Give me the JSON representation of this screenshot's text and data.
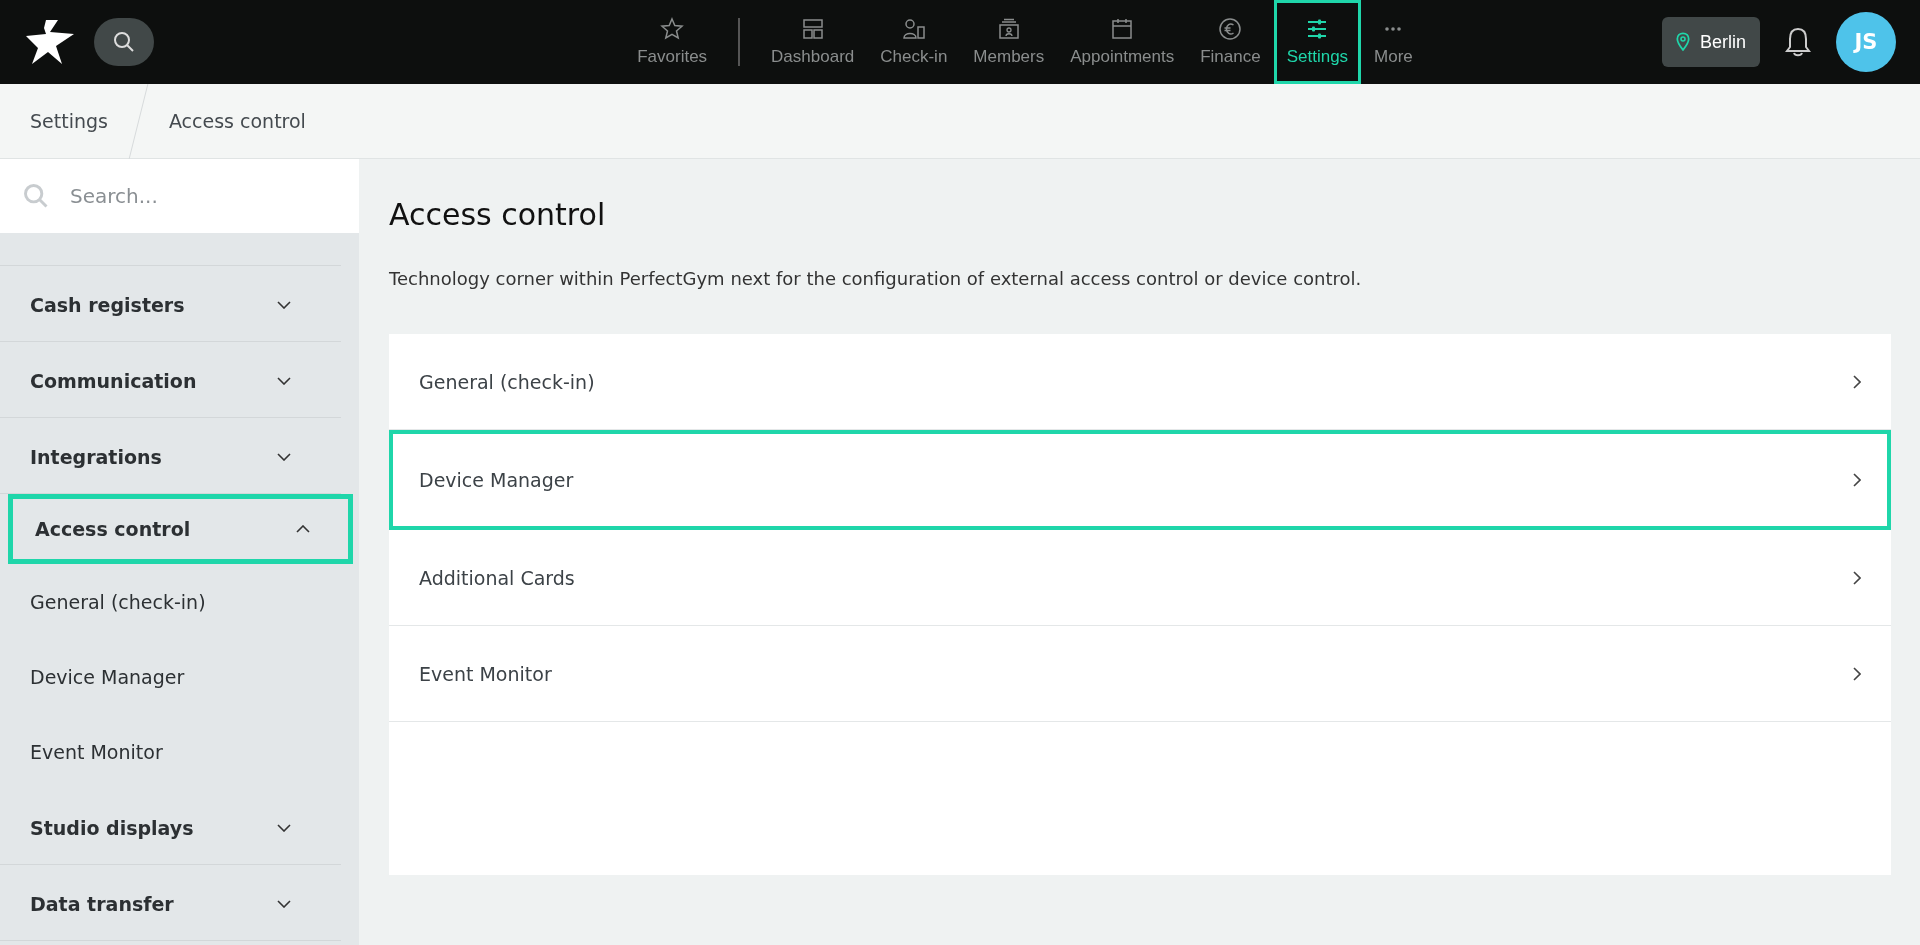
{
  "nav": {
    "items": [
      {
        "kind": "star",
        "label": "Favorites",
        "selected": false,
        "highlighted": false
      },
      {
        "kind": "dashboard",
        "label": "Dashboard",
        "selected": false,
        "highlighted": false
      },
      {
        "kind": "checkin",
        "label": "Check-in",
        "selected": false,
        "highlighted": false
      },
      {
        "kind": "members",
        "label": "Members",
        "selected": false,
        "highlighted": false
      },
      {
        "kind": "calendar",
        "label": "Appointments",
        "selected": false,
        "highlighted": false
      },
      {
        "kind": "euro",
        "label": "Finance",
        "selected": false,
        "highlighted": false
      },
      {
        "kind": "sliders",
        "label": "Settings",
        "selected": true,
        "highlighted": true
      },
      {
        "kind": "dots",
        "label": "More",
        "selected": false,
        "highlighted": false
      }
    ],
    "location": "Berlin",
    "avatar": "JS"
  },
  "breadcrumb": [
    "Settings",
    "Access control"
  ],
  "sidebar": {
    "search": {
      "placeholder": "Search..."
    },
    "items": [
      {
        "label": "Cash registers",
        "expanded": false,
        "highlighted": false
      },
      {
        "label": "Communication",
        "expanded": false,
        "highlighted": false
      },
      {
        "label": "Integrations",
        "expanded": false,
        "highlighted": false
      },
      {
        "label": "Access control",
        "expanded": true,
        "highlighted": true,
        "children": [
          {
            "label": "General (check-in)"
          },
          {
            "label": "Device Manager"
          },
          {
            "label": "Event Monitor"
          }
        ]
      },
      {
        "label": "Studio displays",
        "expanded": false,
        "highlighted": false
      },
      {
        "label": "Data transfer",
        "expanded": false,
        "highlighted": false
      }
    ]
  },
  "main": {
    "title": "Access control",
    "description": "Technology corner within PerfectGym next for the configuration of external access control or device control.",
    "rows": [
      {
        "label": "General (check-in)",
        "highlighted": false
      },
      {
        "label": "Device Manager",
        "highlighted": true
      },
      {
        "label": "Additional Cards",
        "highlighted": false
      },
      {
        "label": "Event Monitor",
        "highlighted": false
      }
    ]
  }
}
